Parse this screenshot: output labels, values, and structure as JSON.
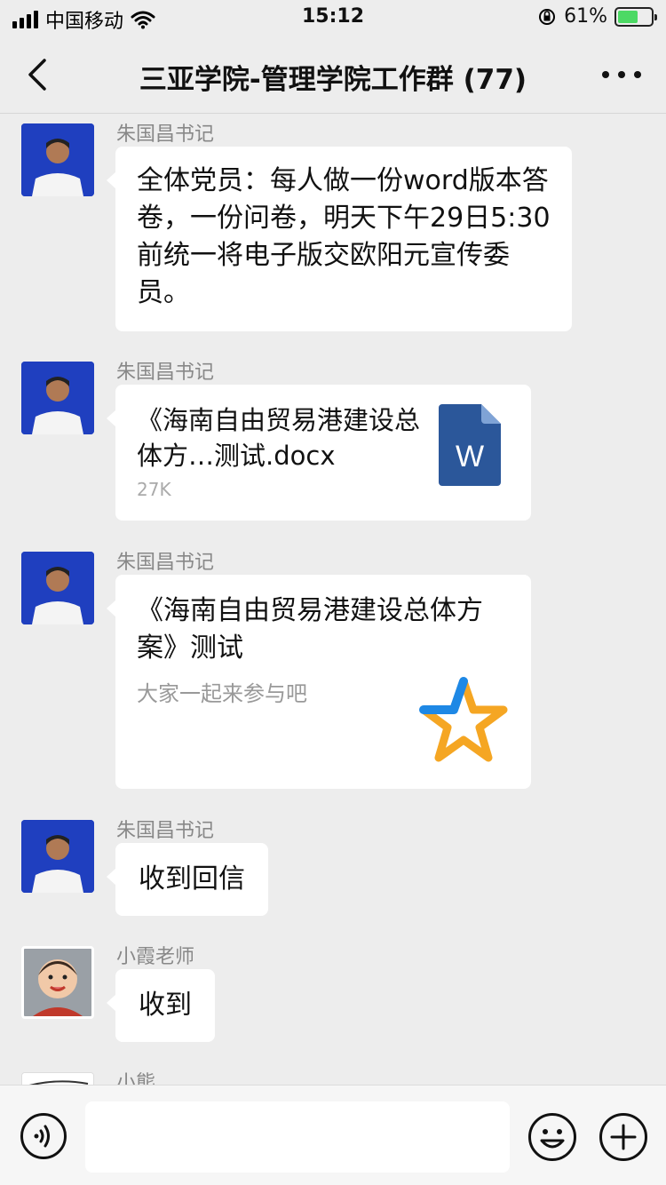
{
  "status_bar": {
    "carrier": "中国移动",
    "time": "15:12",
    "battery": "61%",
    "battery_level": 0.61
  },
  "nav": {
    "title": "三亚学院-管理学院工作群 (77)"
  },
  "messages": [
    {
      "sender": "朱国昌书记",
      "text": "全体党员：每人做一份word版本答卷，一份问卷，明天下午29日5:30前统一将电子版交欧阳元宣传委员。"
    },
    {
      "sender": "朱国昌书记",
      "file_name": "《海南自由贸易港建设总体方…测试.docx",
      "file_size": "27K",
      "file_icon_letter": "W"
    },
    {
      "sender": "朱国昌书记",
      "link_title": "《海南自由贸易港建设总体方案》测试",
      "link_desc": "大家一起来参与吧"
    },
    {
      "sender": "朱国昌书记",
      "text": "收到回信"
    },
    {
      "sender": "小霞老师",
      "text": "收到"
    },
    {
      "sender": "小熊"
    }
  ],
  "colors": {
    "background": "#ededed",
    "bubble": "#ffffff",
    "word_blue": "#2b579a",
    "star_blue": "#1e88e5",
    "star_orange": "#f5a623"
  }
}
